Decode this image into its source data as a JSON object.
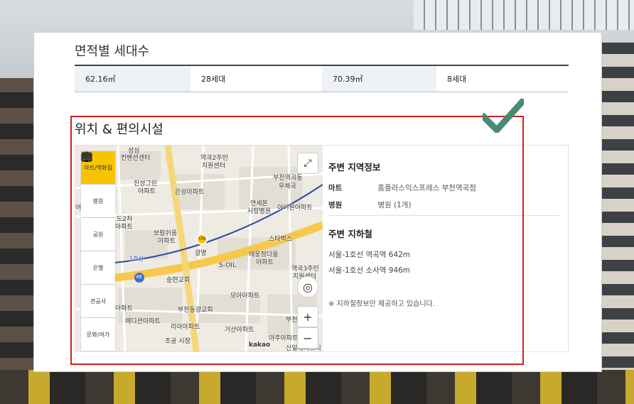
{
  "area_section": {
    "title": "면적별 세대수",
    "rows": [
      {
        "area": "62.16㎡",
        "count": "28세대"
      },
      {
        "area": "70.39㎡",
        "count": "8세대"
      }
    ]
  },
  "location_section": {
    "title": "위치 & 편의시설",
    "categories": [
      {
        "label": "마트/백화점",
        "icon": "cart-icon",
        "active": true
      },
      {
        "label": "병원",
        "icon": "hospital-icon",
        "active": false
      },
      {
        "label": "공원",
        "icon": "park-icon",
        "active": false
      },
      {
        "label": "은행",
        "icon": "bank-card-icon",
        "active": false
      },
      {
        "label": "관공서",
        "icon": "government-icon",
        "active": false
      },
      {
        "label": "문화/여가",
        "icon": "ferris-wheel-icon",
        "active": false
      }
    ],
    "map_labels": {
      "l1": "성심",
      "l2": "컨벤션센터",
      "l3": "역곡2주민",
      "l4": "지원센터",
      "l5": "진성그린",
      "l6": "아파트",
      "l7": "은성아파트",
      "l8": "부천역곡동",
      "l9": "우체국",
      "l10": "연세본",
      "l11": "사랑병원",
      "l12": "아이원아파트",
      "l13": "도2차",
      "l14": "아파트",
      "l15": "보람쉬움",
      "l16": "아파트",
      "l17": "스타벅스",
      "l18": "광명",
      "l19": "태웅정다움",
      "l20": "아파트",
      "l21": "S-OIL",
      "l22": "역곡3주민",
      "l23": "지원센터",
      "l24": "승현교회",
      "l25": "1호선",
      "l26": "46",
      "l27": "모아아파트",
      "l28": "부천동광교회",
      "l29": "에디션아파트",
      "l30": "리아아파트",
      "l31": "거산아파트",
      "l32": "조공 시장",
      "l33": "아주아파트",
      "l34": "신일해피트리",
      "l35": "부천",
      "l36": "어",
      "l37": "아파트",
      "l38": "ON",
      "kakao": "kakao"
    },
    "info": {
      "region_title": "주변 지역정보",
      "mart_label": "마트",
      "mart_value": "홈플러스익스프레스 부천역곡점",
      "hospital_label": "병원",
      "hospital_value": "병원 (1개)",
      "subway_title": "주변 지하철",
      "subway_1": "서울-1호선 역곡역 642m",
      "subway_2": "서울-1호선 소사역 946m",
      "note": "※ 지하철정보만 제공하고 있습니다."
    }
  },
  "colors": {
    "highlight_box": "#d32020",
    "check": "#4a8b6f",
    "active_category": "#f8c400",
    "area_key_bg": "#eef1f6"
  }
}
